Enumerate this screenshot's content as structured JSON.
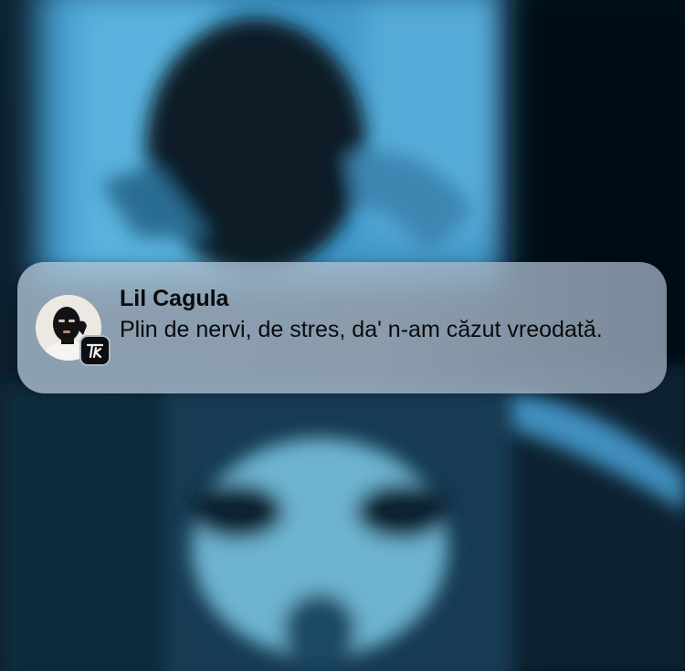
{
  "notification": {
    "sender": "Lil Cagula",
    "message": "Plin de nervi, de stres, da' n-am căzut vreodată.",
    "avatar_icon": "masked-person-avatar-icon",
    "app_icon": "tk-app-badge-icon"
  },
  "wallpaper": {
    "description_icon": "blurred-photo-background"
  }
}
